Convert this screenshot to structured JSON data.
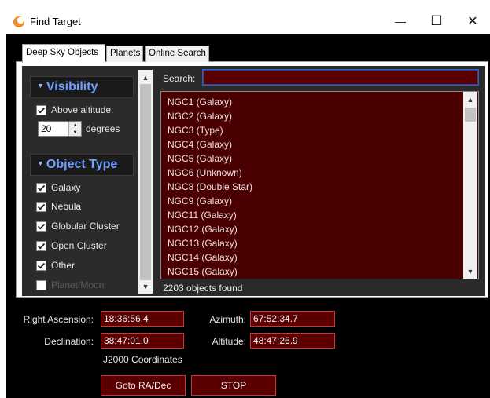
{
  "window": {
    "title": "Find Target",
    "minimize_glyph": "—",
    "maximize_glyph": "☐",
    "close_glyph": "✕"
  },
  "tabs": [
    {
      "label": "Deep Sky Objects",
      "active": true
    },
    {
      "label": "Planets",
      "active": false
    },
    {
      "label": "Online Search",
      "active": false
    }
  ],
  "filters": {
    "visibility_header": "Visibility",
    "above_altitude_label": "Above altitude:",
    "above_altitude_checked": true,
    "altitude_value": "20",
    "degrees_label": "degrees",
    "object_type_header": "Object Type",
    "object_types": [
      {
        "label": "Galaxy",
        "checked": true,
        "enabled": true
      },
      {
        "label": "Nebula",
        "checked": true,
        "enabled": true
      },
      {
        "label": "Globular Cluster",
        "checked": true,
        "enabled": true
      },
      {
        "label": "Open Cluster",
        "checked": true,
        "enabled": true
      },
      {
        "label": "Other",
        "checked": true,
        "enabled": true
      },
      {
        "label": "Planet/Moon",
        "checked": false,
        "enabled": false
      }
    ]
  },
  "search": {
    "label": "Search:",
    "value": ""
  },
  "results": {
    "items": [
      "NGC1 (Galaxy)",
      "NGC2 (Galaxy)",
      "NGC3 (Type)",
      "NGC4 (Galaxy)",
      "NGC5 (Galaxy)",
      "NGC6 (Unknown)",
      "NGC8 (Double Star)",
      "NGC9 (Galaxy)",
      "NGC11 (Galaxy)",
      "NGC12 (Galaxy)",
      "NGC13 (Galaxy)",
      "NGC14 (Galaxy)",
      "NGC15 (Galaxy)"
    ],
    "count_text": "2203 objects found"
  },
  "coordinates": {
    "ra_label": "Right Ascension:",
    "ra_value": "18:36:56.4",
    "dec_label": "Declination:",
    "dec_value": "38:47:01.0",
    "azimuth_label": "Azimuth:",
    "azimuth_value": "67:52:34.7",
    "altitude_label": "Altitude:",
    "altitude_value": "48:47:26.9",
    "epoch_text": "J2000 Coordinates"
  },
  "buttons": {
    "goto_label": "Goto RA/Dec",
    "stop_label": "STOP"
  },
  "colors": {
    "accent_header": "#6fa0ff",
    "field_bg": "#5a0000",
    "field_border": "#c23a3a",
    "list_bg": "#4a0000"
  }
}
